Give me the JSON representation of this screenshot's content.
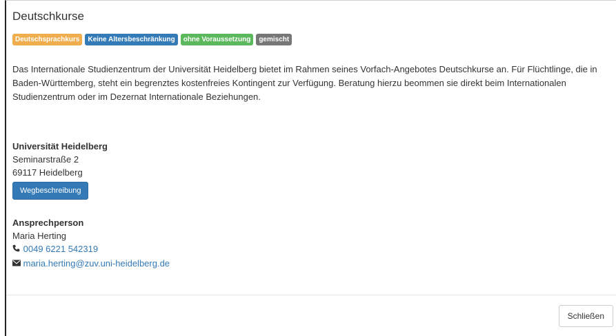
{
  "modal": {
    "title": "Deutschkurse",
    "badges": [
      {
        "label": "Deutschsprachkurs",
        "color": "#f0ad4e"
      },
      {
        "label": "Keine Altersbeschränkung",
        "color": "#337ab7"
      },
      {
        "label": "ohne Voraussetzung",
        "color": "#5cb85c"
      },
      {
        "label": "gemischt",
        "color": "#777777"
      }
    ],
    "description": "Das Internationale Studienzentrum der Universität Heidelberg bietet im Rahmen seines Vorfach-Angebotes Deutschkurse an. Für Flüchtlinge, die in Baden-Württemberg, steht ein begrenztes kostenfreies Kontingent zur Verfügung. Beratung hierzu beommen sie direkt beim Internationalen Studienzentrum oder im Dezernat Internationale Beziehungen.",
    "address": {
      "name": "Universität Heidelberg",
      "street": "Seminarstraße 2",
      "city": "69117 Heidelberg",
      "directions_button": "Wegbeschreibung"
    },
    "contact": {
      "heading": "Ansprechperson",
      "name": "Maria Herting",
      "phone": "0049 6221 542319",
      "email": "maria.herting@zuv.uni-heidelberg.de",
      "phone_icon": "phone-icon",
      "email_icon": "envelope-icon"
    },
    "close_button": "Schließen"
  }
}
